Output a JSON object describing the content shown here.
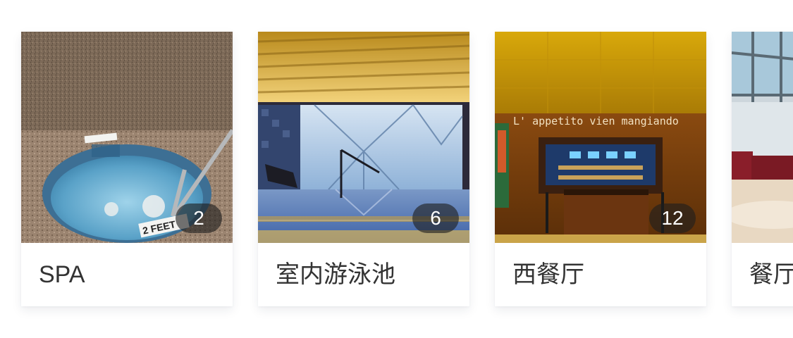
{
  "cards": [
    {
      "name": "SPA",
      "count": "2",
      "photo_sign": "2 FEET"
    },
    {
      "name": "室内游泳池",
      "count": "6"
    },
    {
      "name": "西餐厅",
      "count": "12",
      "photo_sign": "L' appetito vien mangiando"
    },
    {
      "name": "餐厅",
      "count": ""
    }
  ]
}
